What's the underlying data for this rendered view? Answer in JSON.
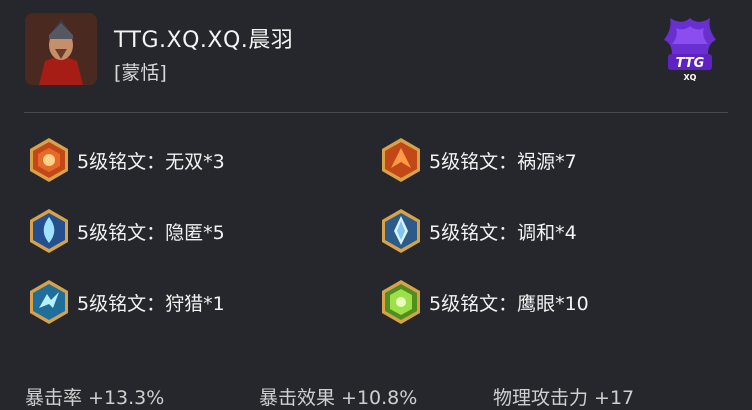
{
  "header": {
    "player_name": "TTG.XQ.XQ.晨羽",
    "hero": "[蒙恬]",
    "logo_text": "TTG",
    "logo_subtext": "XQ"
  },
  "runes": [
    {
      "label": "5级铭文：无双*3",
      "icon": "red-rune-icon",
      "color": "#d9561f"
    },
    {
      "label": "5级铭文：祸源*7",
      "icon": "red-rune-icon",
      "color": "#d9561f"
    },
    {
      "label": "5级铭文：隐匿*5",
      "icon": "blue-rune-icon",
      "color": "#3f8ed6"
    },
    {
      "label": "5级铭文：调和*4",
      "icon": "blue-rune-icon",
      "color": "#4d8fc7"
    },
    {
      "label": "5级铭文：狩猎*1",
      "icon": "cyan-rune-icon",
      "color": "#3fb0d0"
    },
    {
      "label": "5级铭文：鹰眼*10",
      "icon": "green-rune-icon",
      "color": "#69b52f"
    }
  ],
  "stats": [
    {
      "label": "暴击率 +13.3%"
    },
    {
      "label": "暴击效果 +10.8%"
    },
    {
      "label": "物理攻击力 +17"
    }
  ],
  "colors": {
    "background": "#26272c",
    "gold": "#d7a24a"
  }
}
